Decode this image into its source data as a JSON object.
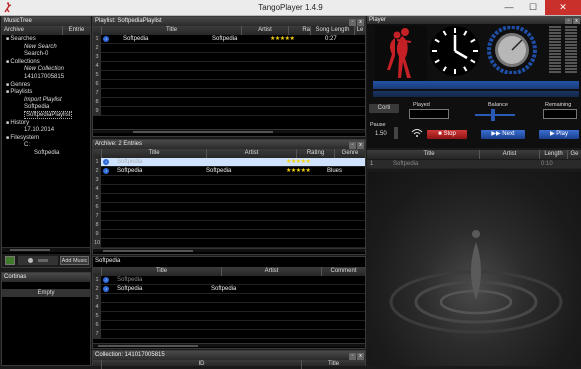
{
  "window": {
    "title": "TangoPlayer 1.4.9"
  },
  "music_tree": {
    "header": "MusicTree",
    "col_archive": "Archive",
    "col_entries": "Entrie",
    "items": [
      {
        "label": "Searches",
        "kind": "group"
      },
      {
        "label": "New Search",
        "kind": "italic"
      },
      {
        "label": "Search-0",
        "kind": "child"
      },
      {
        "label": "Collections",
        "kind": "group"
      },
      {
        "label": "New Collection",
        "kind": "italic"
      },
      {
        "label": "141017005815",
        "kind": "child"
      },
      {
        "label": "Genres",
        "kind": "group"
      },
      {
        "label": "Playlists",
        "kind": "group"
      },
      {
        "label": "Import Playlist",
        "kind": "italic"
      },
      {
        "label": "Softpedia",
        "kind": "child"
      },
      {
        "label": "SoftpediaPlaylist",
        "kind": "selected"
      },
      {
        "label": "History",
        "kind": "group"
      },
      {
        "label": "17.10.2014",
        "kind": "child"
      },
      {
        "label": "Filesystem",
        "kind": "group"
      },
      {
        "label": "C:",
        "kind": "child"
      },
      {
        "label": "Softpedia",
        "kind": "child2"
      }
    ],
    "add_music_label": "Add Music"
  },
  "cortinas": {
    "header": "Cortinas",
    "empty_label": "Empty"
  },
  "playlist": {
    "header": "Playlist: SoftpediaPlaylist",
    "columns": [
      "Title",
      "Artist",
      "Rating",
      "Song Length",
      "Le"
    ],
    "rows": [
      {
        "num": "1",
        "title": "Softpedia",
        "artist": "Softpedia",
        "rating": "★★★★★",
        "length": "0:27"
      }
    ],
    "row_numbers": [
      "1",
      "2",
      "3",
      "4",
      "5",
      "6",
      "7",
      "8",
      "9"
    ]
  },
  "archive": {
    "header": "Archive: 2 Entries",
    "columns": [
      "Title",
      "Artist",
      "Rating",
      "Genre"
    ],
    "rows": [
      {
        "num": "1",
        "title": "Softpedia",
        "artist": "",
        "rating": "★★★★★",
        "genre": ""
      },
      {
        "num": "2",
        "title": "Softpedia",
        "artist": "Softpedia",
        "rating": "★★★★★",
        "genre": "Blues"
      }
    ],
    "row_numbers": [
      "1",
      "2",
      "3",
      "4",
      "5",
      "6",
      "7",
      "8",
      "9",
      "10"
    ]
  },
  "softpedia_panel": {
    "header": "Softpedia",
    "columns": [
      "Title",
      "Artist",
      "Comment"
    ],
    "rows": [
      {
        "num": "1",
        "title": "Softpedia",
        "artist": "",
        "comment": ""
      },
      {
        "num": "2",
        "title": "Softpedia",
        "artist": "Softpedia",
        "comment": ""
      }
    ],
    "row_numbers": [
      "1",
      "2",
      "3",
      "4",
      "5",
      "6",
      "7"
    ]
  },
  "collection": {
    "header": "Collection: 141017005815",
    "columns": [
      "ID",
      "Title"
    ]
  },
  "player": {
    "header": "Player",
    "played_label": "Played",
    "balance_label": "Balance",
    "remaining_label": "Remaining",
    "cortina_label": "Corti",
    "pause_label": "Pause",
    "pause_value": "1.50",
    "stop_label": "Stop",
    "next_label": "Next",
    "play_label": "Play",
    "queue_columns": [
      "Title",
      "Artist",
      "Length",
      "Ge"
    ],
    "queue_rows": [
      {
        "num": "1",
        "title": "Softpedia",
        "artist": "",
        "length": "0:10"
      }
    ]
  },
  "watermark": "SOFTPEDIA"
}
